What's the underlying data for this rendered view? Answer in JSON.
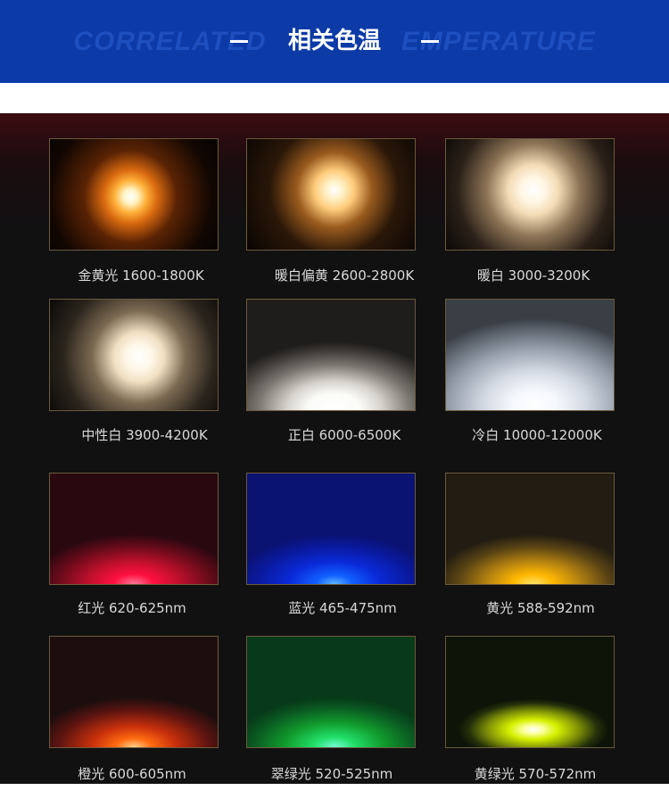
{
  "banner": {
    "title": "相关色温",
    "background_text": "CORRELATED COLOR TEMPERATURE",
    "colors": {
      "banner": "#0c3aa6",
      "panel": "#111111",
      "caption": "#d9d9d9"
    }
  },
  "tiles": [
    {
      "label": "金黄光 1600-1800K",
      "effect": "warm-amber-spot"
    },
    {
      "label": "暖白偏黄 2600-2800K",
      "effect": "warm-yellow-spot"
    },
    {
      "label": "暖白 3000-3200K",
      "effect": "warm-white-spot"
    },
    {
      "label": "中性白 3900-4200K",
      "effect": "neutral-white-spot"
    },
    {
      "label": "正白 6000-6500K",
      "effect": "pure-white-floodlight"
    },
    {
      "label": "冷白 10000-12000K",
      "effect": "cool-white-floodlight"
    },
    {
      "label": "红光 620-625nm",
      "effect": "red-floodlight"
    },
    {
      "label": "蓝光 465-475nm",
      "effect": "blue-floodlight"
    },
    {
      "label": "黄光 588-592nm",
      "effect": "yellow-floodlight"
    },
    {
      "label": "橙光 600-605nm",
      "effect": "orange-floodlight"
    },
    {
      "label": "翠绿光  520-525nm",
      "effect": "green-floodlight"
    },
    {
      "label": "黄绿光  570-572nm",
      "effect": "yellow-green-floodlight"
    }
  ]
}
